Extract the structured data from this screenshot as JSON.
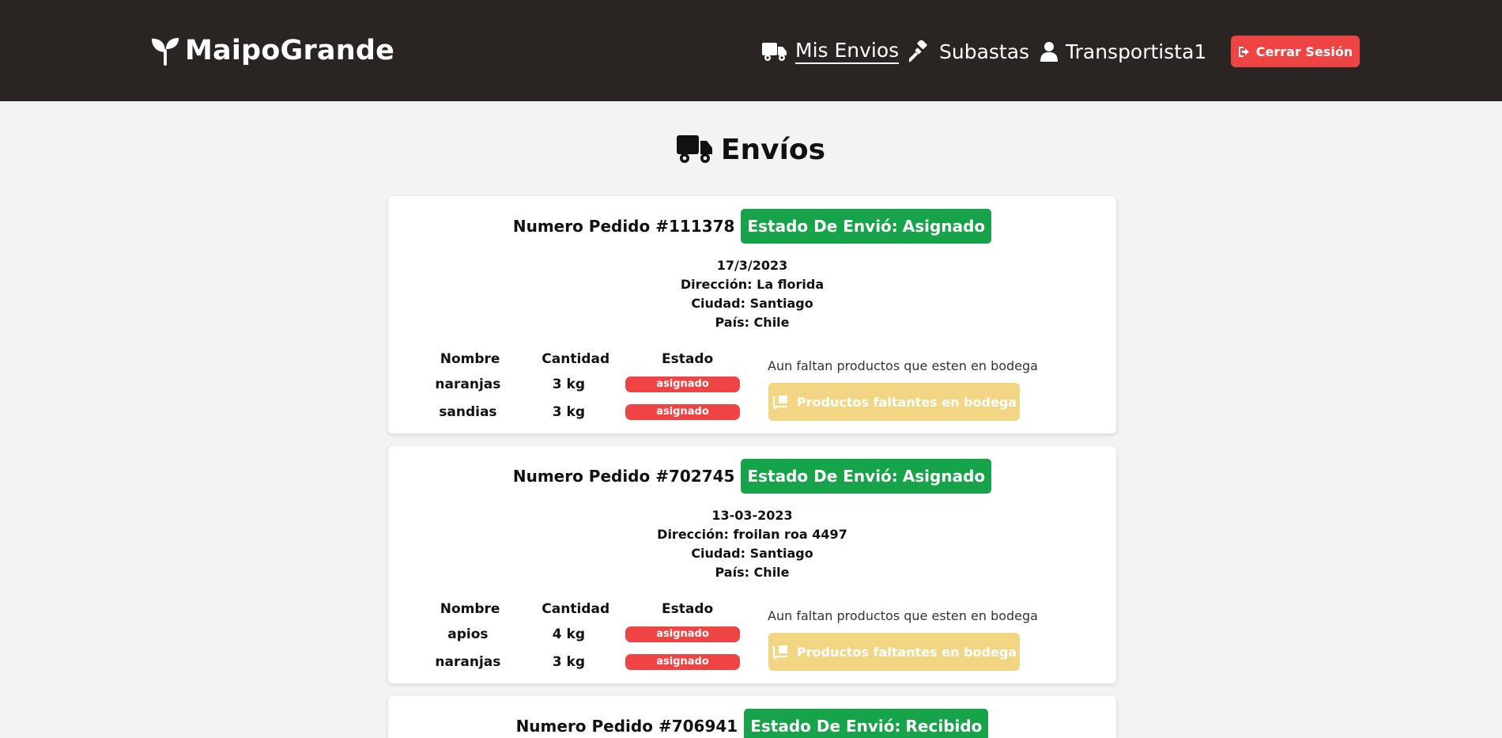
{
  "app": {
    "brand": "MaipoGrande"
  },
  "nav": {
    "envios": "Mis Envios",
    "subastas": "Subastas",
    "user": "Transportista1",
    "logout": "Cerrar Sesión"
  },
  "page": {
    "title": "Envíos"
  },
  "labels": {
    "order_prefix": "Numero Pedido",
    "state_prefix": "Estado De Envió:",
    "col_name": "Nombre",
    "col_qty": "Cantidad",
    "col_state": "Estado",
    "missing_text": "Aun faltan productos que esten en bodega",
    "missing_button": "Productos faltantes en bodega"
  },
  "colors": {
    "header_bg": "#2a2523",
    "accent_red": "#ef4444",
    "status_green": "#17a34a",
    "pending_yellow": "#f2d683"
  },
  "orders": [
    {
      "number": "#111378",
      "state": "Asignado",
      "date": "17/3/2023",
      "address": "Dirección: La florida",
      "city": "Ciudad: Santiago",
      "country": "País: Chile",
      "products": [
        {
          "name": "naranjas",
          "qty": "3 kg",
          "state": "asignado"
        },
        {
          "name": "sandias",
          "qty": "3 kg",
          "state": "asignado"
        }
      ]
    },
    {
      "number": "#702745",
      "state": "Asignado",
      "date": "13-03-2023",
      "address": "Dirección: froilan roa 4497",
      "city": "Ciudad: Santiago",
      "country": "País: Chile",
      "products": [
        {
          "name": "apios",
          "qty": "4 kg",
          "state": "asignado"
        },
        {
          "name": "naranjas",
          "qty": "3 kg",
          "state": "asignado"
        }
      ]
    },
    {
      "number": "#706941",
      "state": "Recibido"
    }
  ]
}
